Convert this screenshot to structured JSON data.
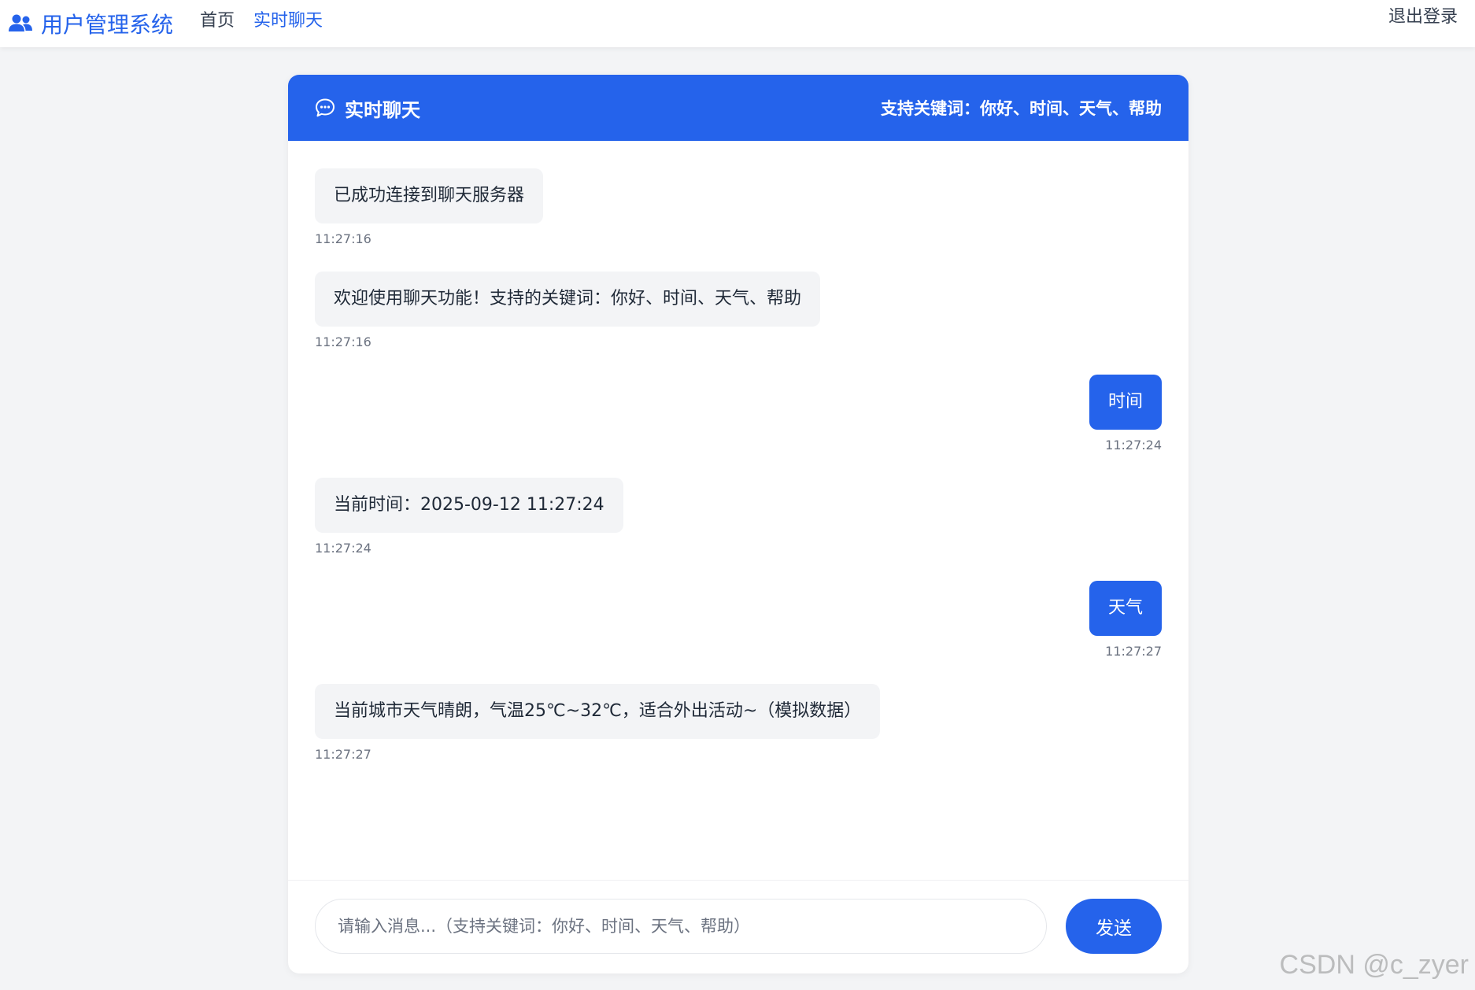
{
  "navbar": {
    "brand_icon": "users-icon",
    "brand_title": "用户管理系统",
    "links": [
      {
        "label": "首页",
        "active": false
      },
      {
        "label": "实时聊天",
        "active": true
      }
    ],
    "logout_label": "退出登录"
  },
  "chat": {
    "header_icon": "chat-bubble-icon",
    "title": "实时聊天",
    "hint": "支持关键词：你好、时间、天气、帮助",
    "messages": [
      {
        "side": "left",
        "text": "已成功连接到聊天服务器",
        "time": "11:27:16"
      },
      {
        "side": "left",
        "text": "欢迎使用聊天功能！支持的关键词：你好、时间、天气、帮助",
        "time": "11:27:16"
      },
      {
        "side": "right",
        "text": "时间",
        "time": "11:27:24"
      },
      {
        "side": "left",
        "text": "当前时间：2025-09-12 11:27:24",
        "time": "11:27:24"
      },
      {
        "side": "right",
        "text": "天气",
        "time": "11:27:27"
      },
      {
        "side": "left",
        "text": "当前城市天气晴朗，气温25℃~32℃，适合外出活动~（模拟数据）",
        "time": "11:27:27"
      }
    ],
    "input": {
      "value": "",
      "placeholder": "请输入消息...（支持关键词：你好、时间、天气、帮助）"
    },
    "send_label": "发送"
  },
  "watermark": "CSDN @c_zyer",
  "colors": {
    "accent": "#2563eb",
    "background": "#f3f4f6",
    "bubble_received": "#f3f4f6"
  }
}
